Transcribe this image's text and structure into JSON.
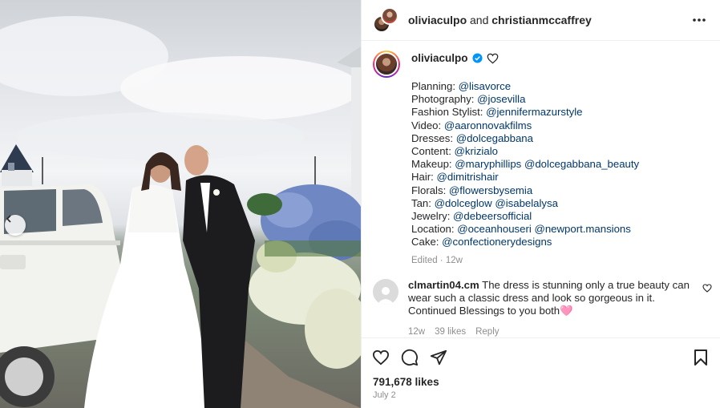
{
  "header": {
    "user1": "oliviaculpo",
    "joiner": "and",
    "user2": "christianmccaffrey"
  },
  "caption": {
    "username": "oliviaculpo",
    "lines": [
      {
        "label": "Planning:",
        "tags": [
          "@lisavorce"
        ]
      },
      {
        "label": "Photography:",
        "tags": [
          "@josevilla"
        ]
      },
      {
        "label": "Fashion Stylist:",
        "tags": [
          "@jennifermazurstyle"
        ]
      },
      {
        "label": "Video:",
        "tags": [
          "@aaronnovakfilms"
        ]
      },
      {
        "label": "Dresses:",
        "tags": [
          "@dolcegabbana"
        ]
      },
      {
        "label": "Content:",
        "tags": [
          "@krizialo"
        ]
      },
      {
        "label": "Makeup:",
        "tags": [
          "@maryphillips",
          "@dolcegabbana_beauty"
        ]
      },
      {
        "label": "Hair:",
        "tags": [
          "@dimitrishair"
        ]
      },
      {
        "label": "Florals:",
        "tags": [
          "@flowersbysemia"
        ]
      },
      {
        "label": "Tan:",
        "tags": [
          "@dolceglow",
          "@isabelalysa"
        ]
      },
      {
        "label": "Jewelry:",
        "tags": [
          "@debeersofficial"
        ]
      },
      {
        "label": "Location:",
        "tags": [
          "@oceanhouseri",
          "@newport.mansions"
        ]
      },
      {
        "label": "Cake:",
        "tags": [
          "@confectionerydesigns"
        ]
      }
    ],
    "meta": "Edited · 12w"
  },
  "comment": {
    "username": "clmartin04.cm",
    "text": "The dress is stunning only a true beauty can wear such a classic dress and look so gorgeous in it. Continued Blessings to you both🩷",
    "time": "12w",
    "likes": "39 likes",
    "reply": "Reply"
  },
  "likes": "791,678 likes",
  "date": "July 2",
  "colors": {
    "link": "#00376b",
    "verified": "#0095f6",
    "muted": "#8e8e8e"
  }
}
